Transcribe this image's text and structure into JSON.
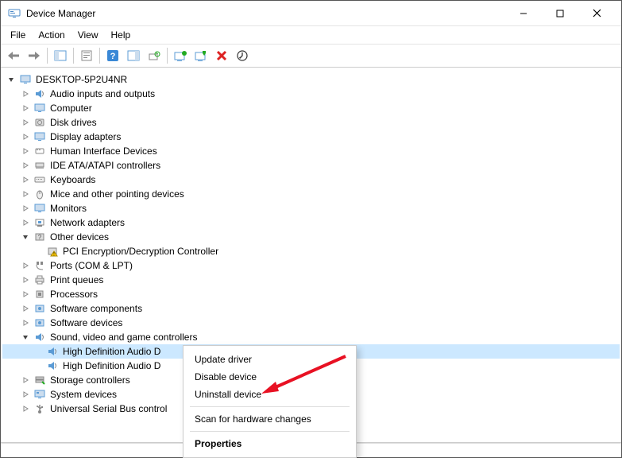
{
  "window": {
    "title": "Device Manager"
  },
  "menubar": {
    "file": "File",
    "action": "Action",
    "view": "View",
    "help": "Help"
  },
  "toolbar": {
    "back": "Back",
    "forward": "Forward",
    "console_tree": "Show/Hide Console Tree",
    "properties": "Properties",
    "help": "Help",
    "action_center": "Show/Hide Action Pane",
    "scan": "Scan for hardware changes",
    "add_legacy": "Add legacy hardware",
    "update": "Update device drivers",
    "uninstall": "Uninstall device",
    "disable": "Disable device"
  },
  "tree": {
    "root": "DESKTOP-5P2U4NR",
    "items": [
      {
        "label": "Audio inputs and outputs",
        "icon": "speaker"
      },
      {
        "label": "Computer",
        "icon": "monitor"
      },
      {
        "label": "Disk drives",
        "icon": "disk"
      },
      {
        "label": "Display adapters",
        "icon": "monitor"
      },
      {
        "label": "Human Interface Devices",
        "icon": "hid"
      },
      {
        "label": "IDE ATA/ATAPI controllers",
        "icon": "ide"
      },
      {
        "label": "Keyboards",
        "icon": "keyboard"
      },
      {
        "label": "Mice and other pointing devices",
        "icon": "mouse"
      },
      {
        "label": "Monitors",
        "icon": "monitor"
      },
      {
        "label": "Network adapters",
        "icon": "network"
      },
      {
        "label": "Other devices",
        "icon": "other",
        "expanded": true,
        "children": [
          {
            "label": "PCI Encryption/Decryption Controller",
            "icon": "warn"
          }
        ]
      },
      {
        "label": "Ports (COM & LPT)",
        "icon": "port"
      },
      {
        "label": "Print queues",
        "icon": "printer"
      },
      {
        "label": "Processors",
        "icon": "cpu"
      },
      {
        "label": "Software components",
        "icon": "sw"
      },
      {
        "label": "Software devices",
        "icon": "sw"
      },
      {
        "label": "Sound, video and game controllers",
        "icon": "speaker",
        "expanded": true,
        "children": [
          {
            "label": "High Definition Audio D",
            "icon": "speaker",
            "selected": true
          },
          {
            "label": "High Definition Audio D",
            "icon": "speaker"
          }
        ]
      },
      {
        "label": "Storage controllers",
        "icon": "storage"
      },
      {
        "label": "System devices",
        "icon": "system"
      },
      {
        "label": "Universal Serial Bus control",
        "icon": "usb"
      }
    ]
  },
  "contextmenu": {
    "update": "Update driver",
    "disable": "Disable device",
    "uninstall": "Uninstall device",
    "scan": "Scan for hardware changes",
    "properties": "Properties"
  }
}
